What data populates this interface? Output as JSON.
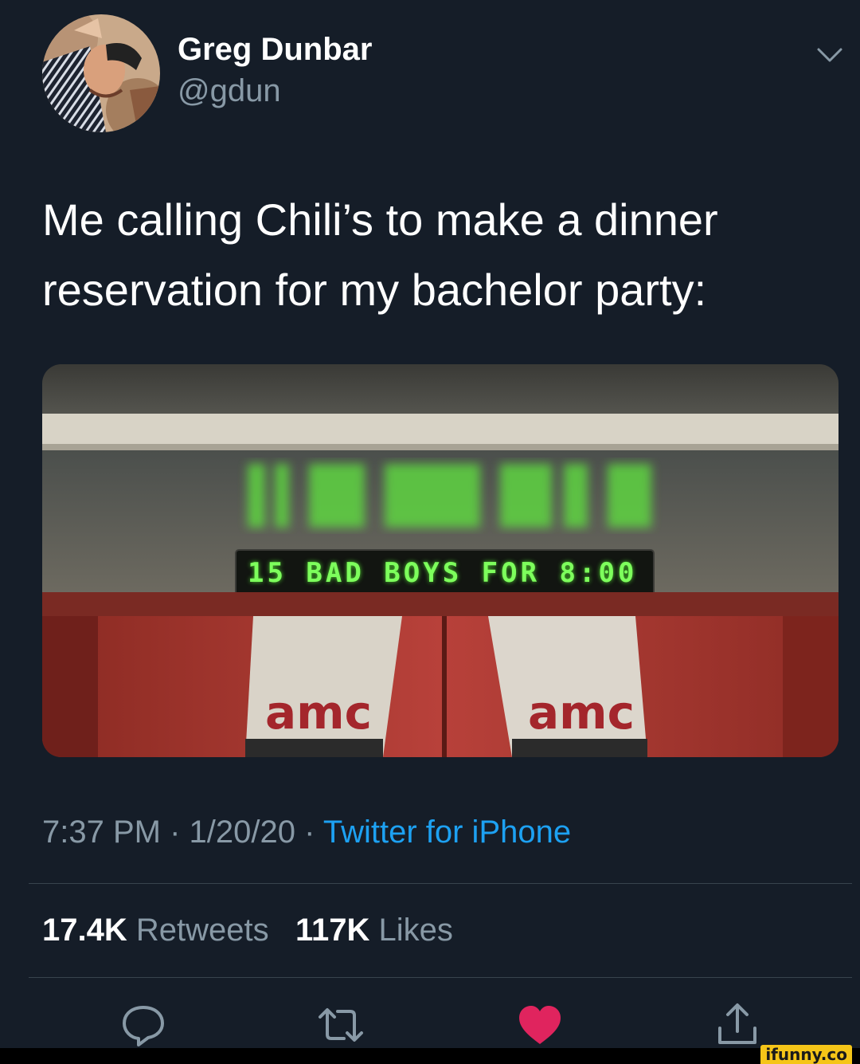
{
  "user": {
    "display_name": "Greg Dunbar",
    "handle": "@gdun"
  },
  "tweet": {
    "text_line1": "Me calling Chili’s to make a dinner",
    "text_line2": "reservation for my bachelor party:"
  },
  "media": {
    "sign_text": "15 BAD BOYS FOR 8:00",
    "logo_left": "amc",
    "logo_right": "amc"
  },
  "meta": {
    "time": "7:37 PM",
    "date": "1/20/20",
    "separator": "·",
    "source": "Twitter for iPhone"
  },
  "stats": {
    "retweets_count": "17.4K",
    "retweets_label": "Retweets",
    "likes_count": "117K",
    "likes_label": "Likes"
  },
  "actions": {
    "reply_icon": "reply-icon",
    "retweet_icon": "retweet-icon",
    "like_icon": "heart-icon",
    "share_icon": "share-icon"
  },
  "watermark": "ifunny.co",
  "colors": {
    "background": "#151d28",
    "link": "#1da1f2",
    "secondary_text": "#8899a6",
    "like": "#e0245e",
    "led_green": "#7dff5c"
  }
}
